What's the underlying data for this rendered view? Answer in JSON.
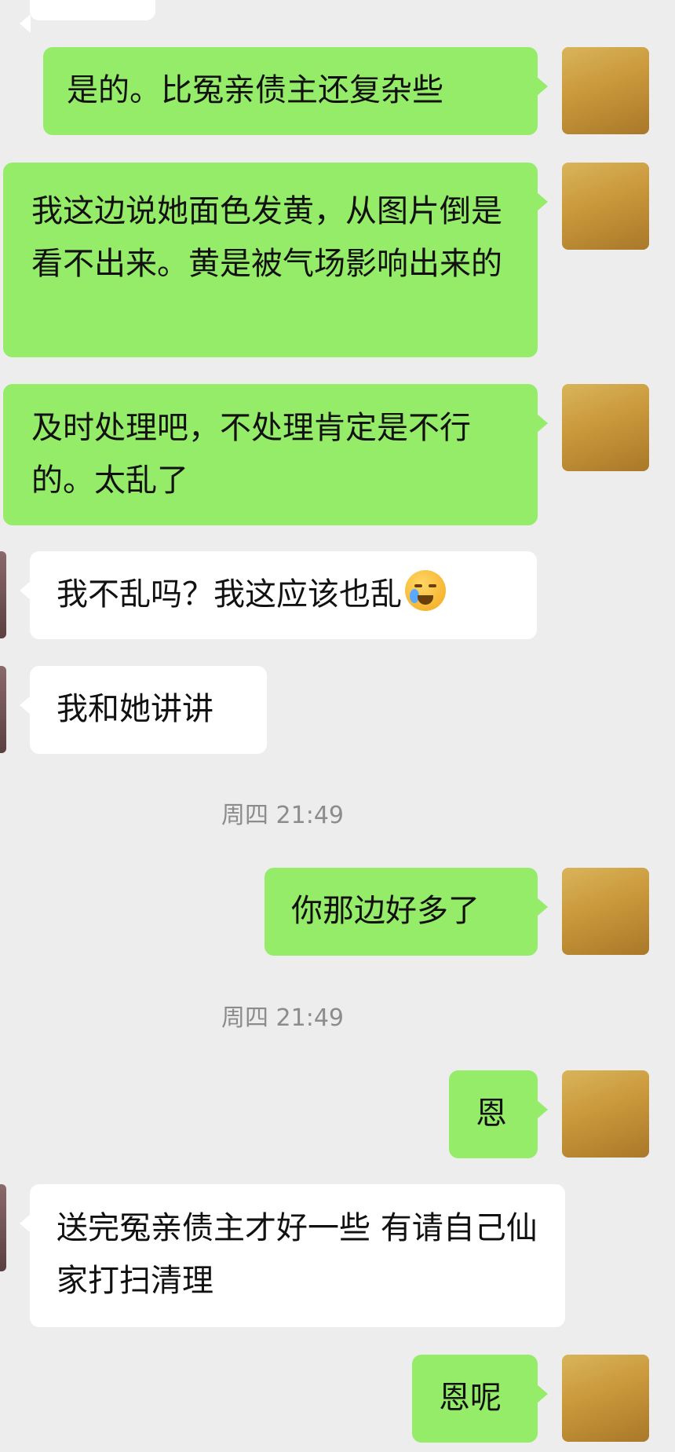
{
  "messages": [
    {
      "text": "是的。比冤亲债主还复杂些"
    },
    {
      "text": "我这边说她面色发黄，从图片倒是看不出来。黄是被气场影响出来的"
    },
    {
      "text": "及时处理吧，不处理肯定是不行的。太乱了"
    },
    {
      "text": "我不乱吗？我这应该也乱",
      "emoji": "crying-laughing-emoji"
    },
    {
      "text": "我和她讲讲"
    },
    {
      "text": "你那边好多了"
    },
    {
      "text": "恩"
    },
    {
      "text": "送完冤亲债主才好一些  有请自己仙家打扫清理"
    },
    {
      "text": "恩呢"
    }
  ],
  "timestamps": [
    "周四 21:49",
    "周四 21:49"
  ],
  "colors": {
    "sent_bubble": "#95ec69",
    "received_bubble": "#ffffff",
    "background": "#ededed",
    "timestamp_text": "#8c8c8c"
  }
}
